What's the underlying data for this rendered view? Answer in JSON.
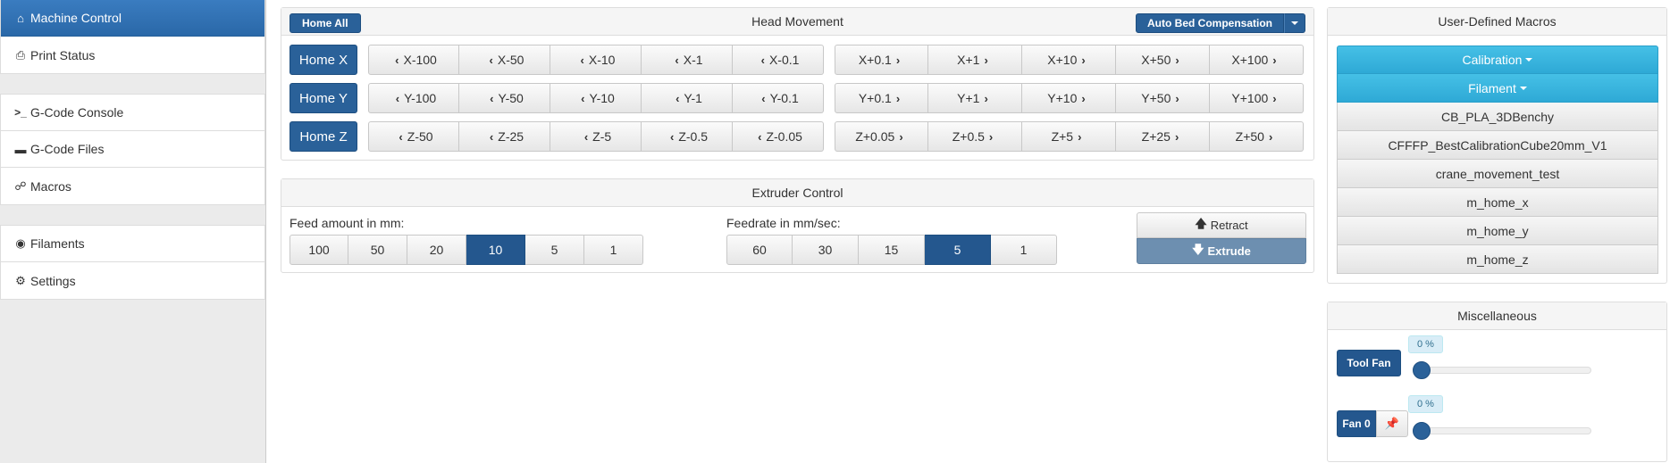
{
  "sidebar": {
    "groups": [
      [
        {
          "label": "Machine Control",
          "icon": "home-icon"
        },
        {
          "label": "Print Status",
          "icon": "printer-icon"
        }
      ],
      [
        {
          "label": "G-Code Console",
          "icon": "terminal-icon"
        },
        {
          "label": "G-Code Files",
          "icon": "hdd-icon"
        },
        {
          "label": "Macros",
          "icon": "link-icon"
        }
      ],
      [
        {
          "label": "Filaments",
          "icon": "globe-icon"
        },
        {
          "label": "Settings",
          "icon": "gear-icon"
        }
      ]
    ]
  },
  "head": {
    "title": "Head Movement",
    "home_all": "Home All",
    "auto_bed": "Auto Bed Compensation",
    "rows": [
      {
        "home": "Home X",
        "neg": [
          "X-100",
          "X-50",
          "X-10",
          "X-1",
          "X-0.1"
        ],
        "pos": [
          "X+0.1",
          "X+1",
          "X+10",
          "X+50",
          "X+100"
        ]
      },
      {
        "home": "Home Y",
        "neg": [
          "Y-100",
          "Y-50",
          "Y-10",
          "Y-1",
          "Y-0.1"
        ],
        "pos": [
          "Y+0.1",
          "Y+1",
          "Y+10",
          "Y+50",
          "Y+100"
        ]
      },
      {
        "home": "Home Z",
        "neg": [
          "Z-50",
          "Z-25",
          "Z-5",
          "Z-0.5",
          "Z-0.05"
        ],
        "pos": [
          "Z+0.05",
          "Z+0.5",
          "Z+5",
          "Z+25",
          "Z+50"
        ]
      }
    ]
  },
  "extruder": {
    "title": "Extruder Control",
    "feed_label": "Feed amount in mm:",
    "feed_amounts": [
      "100",
      "50",
      "20",
      "10",
      "5",
      "1"
    ],
    "feed_selected": "10",
    "feedrate_label": "Feedrate in mm/sec:",
    "feedrates": [
      "60",
      "30",
      "15",
      "5",
      "1"
    ],
    "feedrate_selected": "5",
    "retract": "Retract",
    "extrude": "Extrude"
  },
  "macros": {
    "title": "User-Defined Macros",
    "folders": [
      "Calibration",
      "Filament"
    ],
    "items": [
      "CB_PLA_3DBenchy",
      "CFFFP_BestCalibrationCube20mm_V1",
      "crane_movement_test",
      "m_home_x",
      "m_home_y",
      "m_home_z"
    ]
  },
  "misc": {
    "title": "Miscellaneous",
    "tool_fan": {
      "label": "Tool Fan",
      "value": "0 %"
    },
    "fan0": {
      "label": "Fan 0",
      "value": "0 %",
      "pin_icon": "pushpin-icon"
    }
  },
  "colors": {
    "primary": "#2a6199",
    "active_nav": "#337ab7",
    "info": "#3fb5df",
    "extrude": "#6d8fb0"
  }
}
